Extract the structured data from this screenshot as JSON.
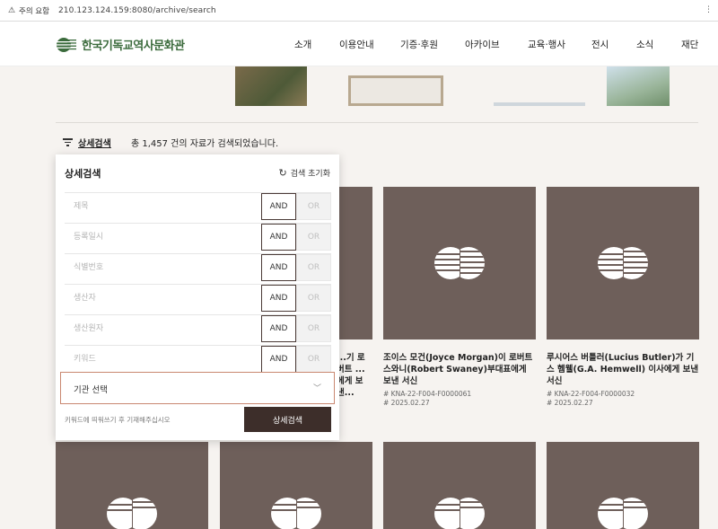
{
  "browser": {
    "security_label": "주의 요함",
    "url": "210.123.124.159:8080/archive/search",
    "menu_glyph": "⋮"
  },
  "site": {
    "logo_text": "한국기독교역사문화관",
    "nav": [
      "소개",
      "이용안내",
      "기증·후원",
      "아카이브",
      "교육·행사",
      "전시",
      "소식",
      "재단"
    ]
  },
  "results": {
    "toggle_label": "상세검색",
    "summary": "총 1,457 건의 자료가 검색되었습니다."
  },
  "panel": {
    "title": "상세검색",
    "reset_label": "검색 초기화",
    "rows": [
      {
        "placeholder": "제목"
      },
      {
        "placeholder": "등록일시"
      },
      {
        "placeholder": "식별번호"
      },
      {
        "placeholder": "생산자"
      },
      {
        "placeholder": "생산원자"
      },
      {
        "placeholder": "키워드"
      }
    ],
    "and_label": "AND",
    "or_label": "OR",
    "select_label": "기관 선택",
    "hint": "키워드에 띄워쓰기 후 기재해주십시오",
    "search_button": "상세검색"
  },
  "cards": [
    {
      "title": "...기 로버트 ...에게 보낸...",
      "id": "",
      "date": ""
    },
    {
      "title": "조이스 모건(Joyce Morgan)이 로버트 스와니(Robert Swaney)부대표에게 보낸 서신",
      "id": "# KNA-22-F004-F0000061",
      "date": "# 2025.02.27"
    },
    {
      "title": "루시어스 버틀러(Lucius Butler)가 기스 헴웰(G.A. Hemwell) 이사에게 보낸 서신",
      "id": "# KNA-22-F004-F0000032",
      "date": "# 2025.02.27"
    }
  ],
  "colors": {
    "card_bg": "#6e5f5a",
    "accent_dark": "#3d2e2a",
    "select_border": "#c98770",
    "logo_green": "#3b6b3c"
  }
}
